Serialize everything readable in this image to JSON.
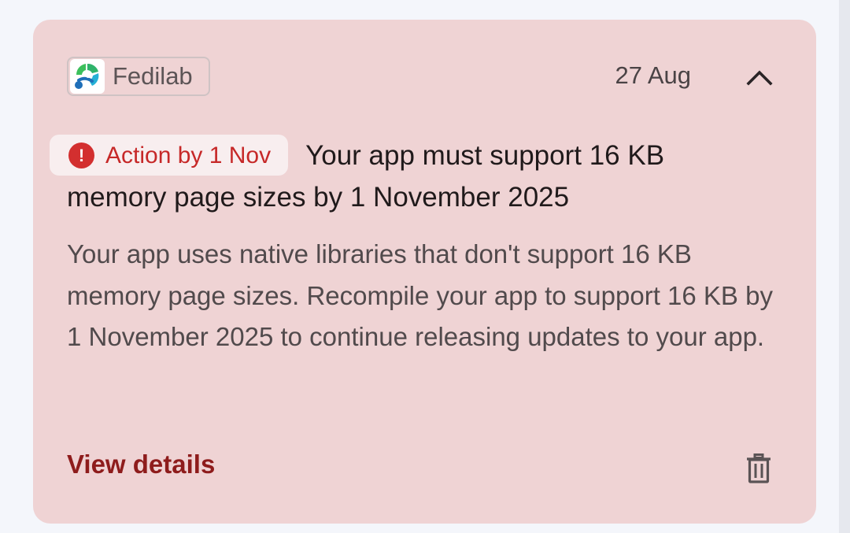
{
  "notification": {
    "app_name": "Fedilab",
    "app_icon": "fedilab-logo",
    "date": "27 Aug",
    "badge": {
      "icon": "alert-circle-icon",
      "label": "Action by 1 Nov",
      "color": "#c62828"
    },
    "title": "Your app must support 16 KB memory page sizes by 1 November 2025",
    "body": "Your app uses native libraries that don't support 16 KB memory page sizes. Recompile your app to support 16 KB by 1 November 2025 to continue releasing updates to your app.",
    "action_label": "View details",
    "icons": {
      "collapse": "chevron-up-icon",
      "delete": "trash-icon"
    },
    "colors": {
      "card_background": "#efd3d4",
      "action_text": "#8e1c1c"
    }
  }
}
